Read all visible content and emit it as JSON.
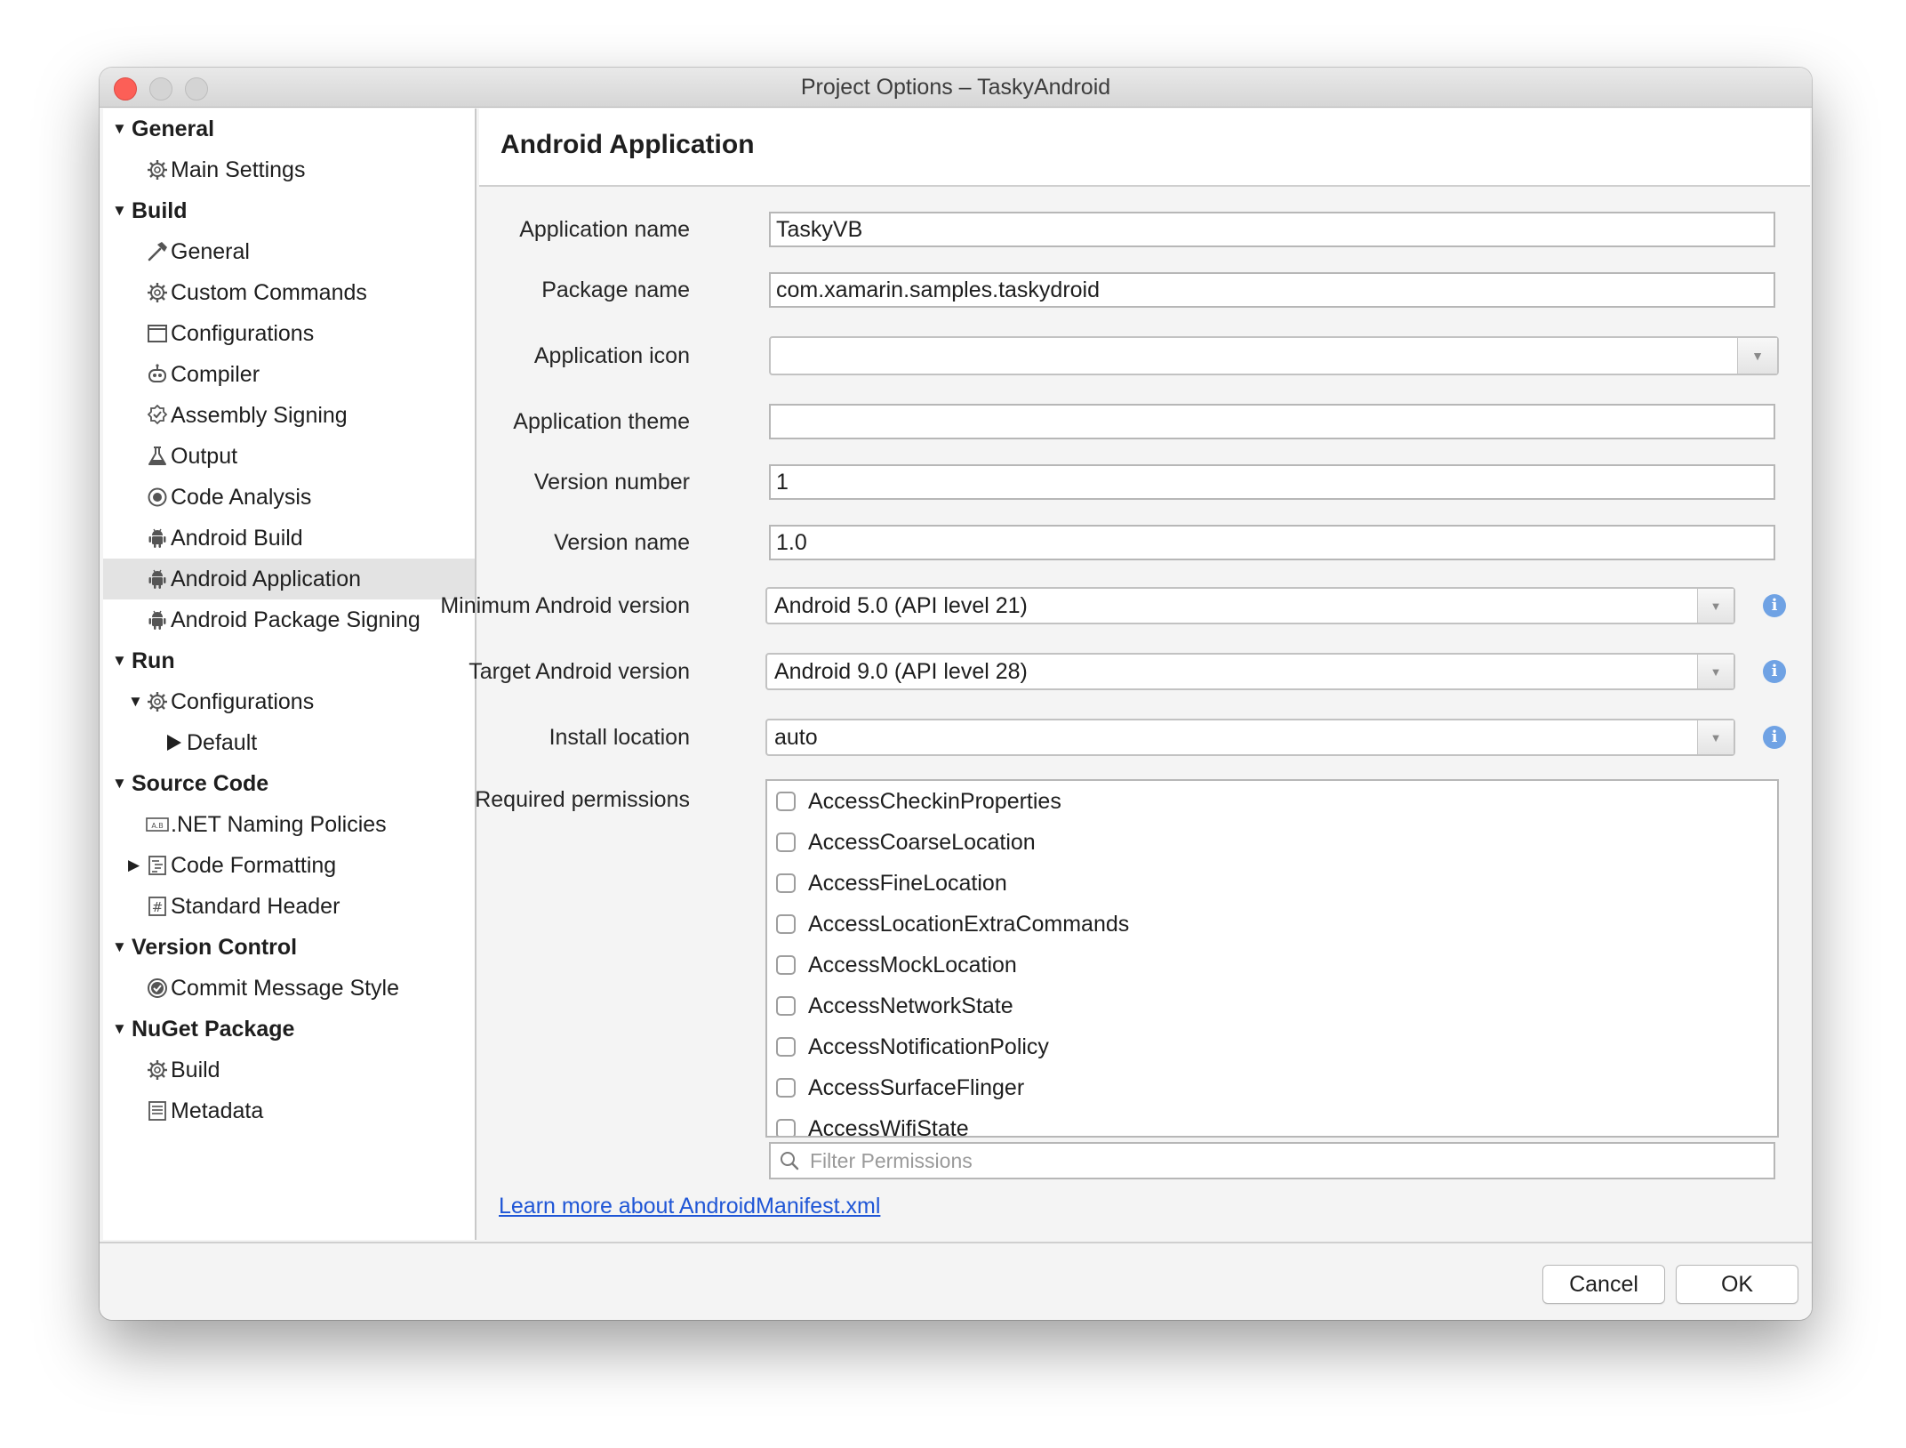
{
  "window": {
    "title": "Project Options – TaskyAndroid"
  },
  "sidebar": {
    "items": [
      {
        "label": "General",
        "kind": "category",
        "expanded": true,
        "level": 0,
        "icon": ""
      },
      {
        "label": "Main Settings",
        "kind": "item",
        "level": 1,
        "icon": "gear-icon"
      },
      {
        "label": "Build",
        "kind": "category",
        "expanded": true,
        "level": 0,
        "icon": ""
      },
      {
        "label": "General",
        "kind": "item",
        "level": 1,
        "icon": "hammer-icon"
      },
      {
        "label": "Custom Commands",
        "kind": "item",
        "level": 1,
        "icon": "gear-icon"
      },
      {
        "label": "Configurations",
        "kind": "item",
        "level": 1,
        "icon": "window-icon"
      },
      {
        "label": "Compiler",
        "kind": "item",
        "level": 1,
        "icon": "robot-icon"
      },
      {
        "label": "Assembly Signing",
        "kind": "item",
        "level": 1,
        "icon": "badge-icon"
      },
      {
        "label": "Output",
        "kind": "item",
        "level": 1,
        "icon": "flask-icon"
      },
      {
        "label": "Code Analysis",
        "kind": "item",
        "level": 1,
        "icon": "target-icon"
      },
      {
        "label": "Android Build",
        "kind": "item",
        "level": 1,
        "icon": "android-icon"
      },
      {
        "label": "Android Application",
        "kind": "item",
        "level": 1,
        "icon": "android-icon",
        "selected": true
      },
      {
        "label": "Android Package Signing",
        "kind": "item",
        "level": 1,
        "icon": "android-icon"
      },
      {
        "label": "Run",
        "kind": "category",
        "expanded": true,
        "level": 0,
        "icon": ""
      },
      {
        "label": "Configurations",
        "kind": "item",
        "level": 1,
        "icon": "gear-icon",
        "expandable": true,
        "expanded": true
      },
      {
        "label": "Default",
        "kind": "item",
        "level": 2,
        "icon": "play-icon"
      },
      {
        "label": "Source Code",
        "kind": "category",
        "expanded": true,
        "level": 0,
        "icon": ""
      },
      {
        "label": ".NET Naming Policies",
        "kind": "item",
        "level": 1,
        "icon": "naming-icon"
      },
      {
        "label": "Code Formatting",
        "kind": "item",
        "level": 1,
        "icon": "format-icon",
        "expandable": true,
        "expanded": false
      },
      {
        "label": "Standard Header",
        "kind": "item",
        "level": 1,
        "icon": "hash-icon"
      },
      {
        "label": "Version Control",
        "kind": "category",
        "expanded": true,
        "level": 0,
        "icon": ""
      },
      {
        "label": "Commit Message Style",
        "kind": "item",
        "level": 1,
        "icon": "check-circle-icon"
      },
      {
        "label": "NuGet Package",
        "kind": "category",
        "expanded": true,
        "level": 0,
        "icon": ""
      },
      {
        "label": "Build",
        "kind": "item",
        "level": 1,
        "icon": "gear-icon"
      },
      {
        "label": "Metadata",
        "kind": "item",
        "level": 1,
        "icon": "document-icon"
      }
    ]
  },
  "content": {
    "heading": "Android Application",
    "fields": {
      "app_name": {
        "label": "Application name",
        "value": "TaskyVB"
      },
      "package_name": {
        "label": "Package name",
        "value": "com.xamarin.samples.taskydroid"
      },
      "app_icon": {
        "label": "Application icon",
        "value": ""
      },
      "app_theme": {
        "label": "Application theme",
        "value": ""
      },
      "version_number": {
        "label": "Version number",
        "value": "1"
      },
      "version_name": {
        "label": "Version name",
        "value": "1.0"
      },
      "min_android": {
        "label": "Minimum Android version",
        "value": "Android 5.0 (API level 21)"
      },
      "target_android": {
        "label": "Target Android version",
        "value": "Android 9.0 (API level 28)"
      },
      "install_location": {
        "label": "Install location",
        "value": "auto"
      }
    },
    "permissions": {
      "label": "Required permissions",
      "items": [
        "AccessCheckinProperties",
        "AccessCoarseLocation",
        "AccessFineLocation",
        "AccessLocationExtraCommands",
        "AccessMockLocation",
        "AccessNetworkState",
        "AccessNotificationPolicy",
        "AccessSurfaceFlinger",
        "AccessWifiState"
      ],
      "filter_placeholder": "Filter Permissions"
    },
    "learn_more_link": "Learn more about AndroidManifest.xml"
  },
  "footer": {
    "cancel_label": "Cancel",
    "ok_label": "OK"
  },
  "colors": {
    "link": "#1f56d6",
    "info": "#6fa2e4",
    "close": "#fc5f57",
    "selection": "#e3e3e3"
  }
}
